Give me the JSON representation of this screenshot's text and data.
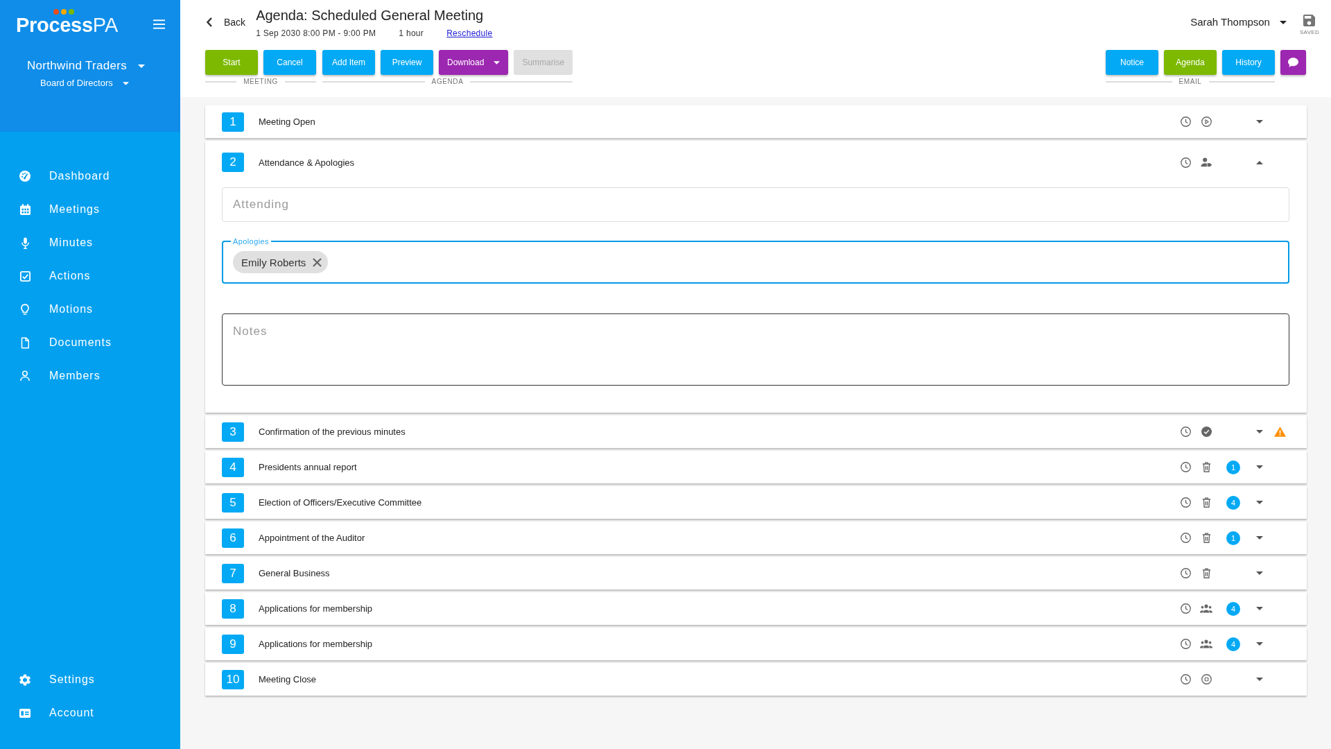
{
  "sidebar": {
    "logo": {
      "name": "Process",
      "suffix": "PA"
    },
    "organization": "Northwind Traders",
    "committee": "Board of Directors",
    "nav_items": [
      "Dashboard",
      "Meetings",
      "Minutes",
      "Actions",
      "Motions",
      "Documents",
      "Members"
    ],
    "bottom_items": [
      "Settings",
      "Account"
    ]
  },
  "header": {
    "back": "Back",
    "title": "Agenda: Scheduled General Meeting",
    "date": "1 Sep 2030 8:00 PM - 9:00 PM",
    "duration": "1 hour",
    "reschedule": "Reschedule",
    "user": "Sarah Thompson",
    "save_status": "SAVED",
    "button_groups": [
      {
        "label": "MEETING",
        "buttons": [
          {
            "label": "Start",
            "color": "#7cb900",
            "disabled": false,
            "dropdown": false
          },
          {
            "label": "Cancel",
            "color": "#03a9f4",
            "disabled": false,
            "dropdown": false
          }
        ]
      },
      {
        "label": "AGENDA",
        "buttons": [
          {
            "label": "Add Item",
            "color": "#03a9f4",
            "disabled": false,
            "dropdown": false
          },
          {
            "label": "Preview",
            "color": "#03a9f4",
            "disabled": false,
            "dropdown": false
          },
          {
            "label": "Download",
            "color": "#9c27b0",
            "disabled": false,
            "dropdown": true
          },
          {
            "label": "Summarise",
            "disabled": true,
            "dropdown": false
          }
        ]
      }
    ],
    "email_group": {
      "label": "EMAIL",
      "buttons": [
        {
          "label": "Notice",
          "color": "#03a9f4"
        },
        {
          "label": "Agenda",
          "color": "#7cb900"
        },
        {
          "label": "History",
          "color": "#03a9f4"
        }
      ]
    }
  },
  "agenda_items": [
    {
      "number": "1",
      "title": "Meeting Open",
      "kind": "open",
      "expanded": false,
      "warning": false
    },
    {
      "number": "2",
      "title": "Attendance & Apologies",
      "kind": "attendance",
      "expanded": true,
      "warning": false,
      "details": {
        "attending": {
          "placeholder": "Attending"
        },
        "apologies": {
          "label": "Apologies",
          "focused": true,
          "chips": [
            "Emily Roberts"
          ]
        },
        "notes": {
          "placeholder": "Notes"
        }
      }
    },
    {
      "number": "3",
      "title": "Confirmation of the previous minutes",
      "kind": "minutes",
      "expanded": false,
      "warning": true
    },
    {
      "number": "4",
      "title": "Presidents annual report",
      "kind": "business",
      "expanded": false,
      "warning": false,
      "count": "1"
    },
    {
      "number": "5",
      "title": "Election of Officers/Executive Committee",
      "kind": "business",
      "expanded": false,
      "warning": false,
      "count": "4"
    },
    {
      "number": "6",
      "title": "Appointment of the Auditor",
      "kind": "business",
      "expanded": false,
      "warning": false,
      "count": "1"
    },
    {
      "number": "7",
      "title": "General Business",
      "kind": "business",
      "expanded": false,
      "warning": false
    },
    {
      "number": "8",
      "title": "Applications for membership",
      "kind": "membership",
      "expanded": false,
      "warning": false,
      "count": "4"
    },
    {
      "number": "9",
      "title": "Applications for membership",
      "kind": "membership",
      "expanded": false,
      "warning": false,
      "count": "4"
    },
    {
      "number": "10",
      "title": "Meeting Close",
      "kind": "close",
      "expanded": false,
      "warning": false
    }
  ]
}
